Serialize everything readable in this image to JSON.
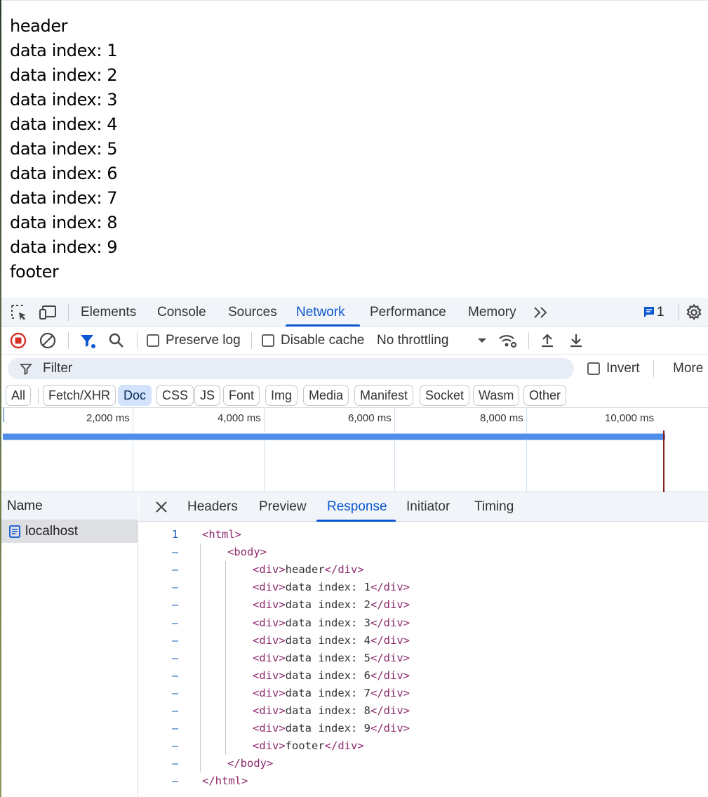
{
  "page": {
    "lines": [
      "header",
      "data index: 1",
      "data index: 2",
      "data index: 3",
      "data index: 4",
      "data index: 5",
      "data index: 6",
      "data index: 7",
      "data index: 8",
      "data index: 9",
      "footer"
    ]
  },
  "devtools": {
    "tabs": [
      "Elements",
      "Console",
      "Sources",
      "Network",
      "Performance",
      "Memory"
    ],
    "active_tab": "Network",
    "more_tabs_icon": "double-chevron-right-icon",
    "issues_count": "1",
    "toolbar": {
      "preserve_log": "Preserve log",
      "disable_cache": "Disable cache",
      "throttling": "No throttling"
    },
    "filter": {
      "placeholder": "Filter",
      "invert": "Invert",
      "more": "More"
    },
    "type_filters": [
      "All",
      "Fetch/XHR",
      "Doc",
      "CSS",
      "JS",
      "Font",
      "Img",
      "Media",
      "Manifest",
      "Socket",
      "Wasm",
      "Other"
    ],
    "active_type": "Doc",
    "timeline": {
      "ticks": [
        "2,000 ms",
        "4,000 ms",
        "6,000 ms",
        "8,000 ms",
        "10,000 ms"
      ]
    },
    "requests": {
      "column": "Name",
      "items": [
        "localhost"
      ]
    },
    "detail": {
      "tabs": [
        "Headers",
        "Preview",
        "Response",
        "Initiator",
        "Timing"
      ],
      "active_tab": "Response",
      "line_number": "1",
      "collapsed_marker": "–",
      "code": [
        {
          "open": "<html>",
          "text": "",
          "close": ""
        },
        {
          "open": "<body>",
          "text": "",
          "close": ""
        },
        {
          "open": "<div>",
          "text": "header",
          "close": "</div>"
        },
        {
          "open": "<div>",
          "text": "data index: 1",
          "close": "</div>"
        },
        {
          "open": "<div>",
          "text": "data index: 2",
          "close": "</div>"
        },
        {
          "open": "<div>",
          "text": "data index: 3",
          "close": "</div>"
        },
        {
          "open": "<div>",
          "text": "data index: 4",
          "close": "</div>"
        },
        {
          "open": "<div>",
          "text": "data index: 5",
          "close": "</div>"
        },
        {
          "open": "<div>",
          "text": "data index: 6",
          "close": "</div>"
        },
        {
          "open": "<div>",
          "text": "data index: 7",
          "close": "</div>"
        },
        {
          "open": "<div>",
          "text": "data index: 8",
          "close": "</div>"
        },
        {
          "open": "<div>",
          "text": "data index: 9",
          "close": "</div>"
        },
        {
          "open": "<div>",
          "text": "footer",
          "close": "</div>"
        },
        {
          "open": "</body>",
          "text": "",
          "close": ""
        },
        {
          "open": "</html>",
          "text": "",
          "close": ""
        }
      ]
    }
  },
  "colors": {
    "accent": "#0b57d0",
    "tag": "#8c2a6b",
    "record_red": "#d93025",
    "chip_active_bg": "#d3e3fd"
  }
}
